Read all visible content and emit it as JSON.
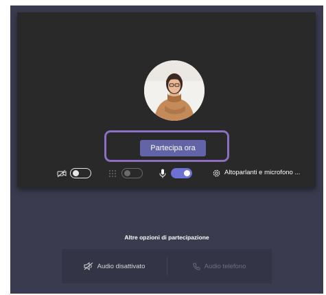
{
  "prejoin": {
    "join_button_label": "Partecipa ora",
    "controls": {
      "camera": {
        "icon": "camera-off-icon",
        "state": "off"
      },
      "background_blur": {
        "icon": "background-blur-icon",
        "state": "off",
        "enabled": false
      },
      "microphone": {
        "icon": "microphone-icon",
        "state": "on"
      },
      "device_settings_label": "Altoparlanti e microfono ...",
      "device_settings_icon": "gear-icon"
    }
  },
  "other_options": {
    "title": "Altre opzioni di partecipazione",
    "audio_off_label": "Audio disattivato",
    "audio_off_icon": "speaker-off-icon",
    "phone_audio_label": "Audio telefono",
    "phone_audio_icon": "phone-icon"
  },
  "colors": {
    "accent": "#6264a7",
    "highlight_border": "#8e6fc2",
    "toggle_on": "#6d72d2",
    "preview_bg": "#2a2929",
    "stage_bg": "#3a3b4f"
  }
}
